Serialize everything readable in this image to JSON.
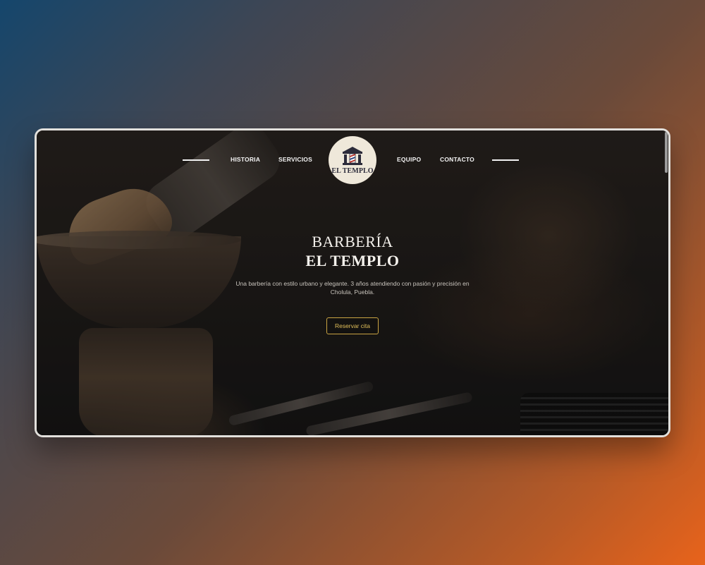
{
  "nav": {
    "left_links": [
      "HISTORIA",
      "SERVICIOS"
    ],
    "right_links": [
      "EQUIPO",
      "CONTACTO"
    ],
    "logo_text": "EL TEMPLO"
  },
  "hero": {
    "title_line1": "BARBERÍA",
    "title_line2": "EL TEMPLO",
    "description": "Una barbería con estilo urbano y elegante. 3 años atendiendo con pasión y precisión en Cholula, Puebla.",
    "cta_label": "Reservar cita"
  },
  "colors": {
    "accent": "#c9a443",
    "logo_bg": "#efe8da",
    "logo_ink": "#2c2b3a",
    "pole_red": "#b5302a",
    "pole_blue": "#2c3f7a"
  },
  "icons": {
    "logo": "barber-temple-pole-icon"
  }
}
